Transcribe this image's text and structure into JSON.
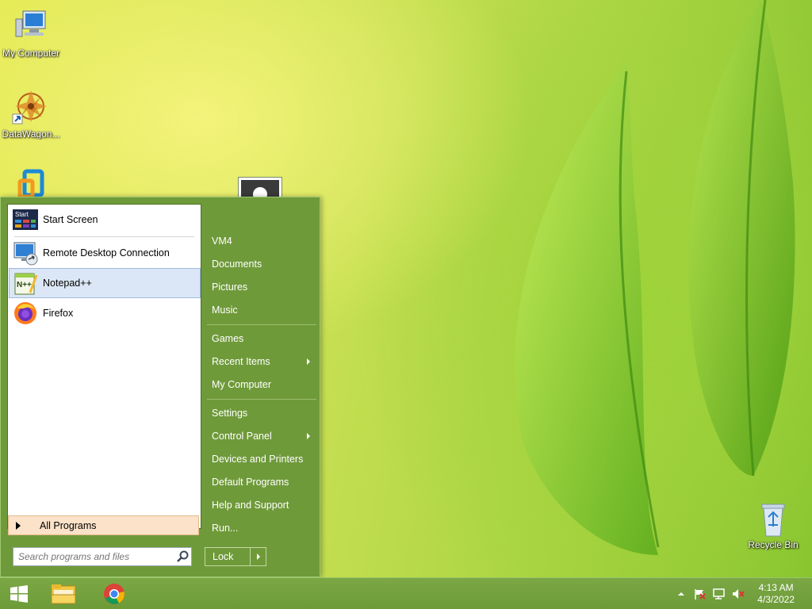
{
  "desktop": {
    "icons": [
      {
        "label": "My Computer"
      },
      {
        "label": "DataWagon..."
      },
      {
        "label": "Recycle Bin"
      }
    ]
  },
  "start_menu": {
    "programs": [
      {
        "label": "Start Screen",
        "icon": "start-screen-icon",
        "icon_text": "Start"
      },
      {
        "label": "Remote Desktop Connection",
        "icon": "remote-desktop-icon"
      },
      {
        "label": "Notepad++",
        "icon": "notepad-plus-plus-icon",
        "icon_text": "N++",
        "highlighted": true
      },
      {
        "label": "Firefox",
        "icon": "firefox-icon"
      }
    ],
    "all_programs": "All Programs",
    "search_placeholder": "Search programs and files",
    "right_links": [
      {
        "label": "VM4"
      },
      {
        "label": "Documents"
      },
      {
        "label": "Pictures"
      },
      {
        "label": "Music"
      },
      {
        "label": "Games"
      },
      {
        "label": "Recent Items",
        "submenu": true
      },
      {
        "label": "My Computer"
      },
      {
        "label": "Settings"
      },
      {
        "label": "Control Panel",
        "submenu": true
      },
      {
        "label": "Devices and Printers"
      },
      {
        "label": "Default Programs"
      },
      {
        "label": "Help and Support"
      },
      {
        "label": "Run..."
      }
    ],
    "lock_label": "Lock"
  },
  "taskbar": {
    "pinned": [
      {
        "name": "start-button",
        "icon": "windows-logo-icon"
      },
      {
        "name": "file-explorer",
        "icon": "folder-icon"
      },
      {
        "name": "chrome",
        "icon": "chrome-icon"
      }
    ],
    "tray_icons": [
      "show-hidden-icons-chevron",
      "action-center-flag-icon",
      "network-icon",
      "volume-muted-icon"
    ],
    "time": "4:13 AM",
    "date": "4/3/2022"
  },
  "colors": {
    "menu_green": "#6f9a3a",
    "taskbar_green": "#73a13e",
    "highlight": "#dbe7f6",
    "all_programs_bg": "#fbe2c8"
  }
}
